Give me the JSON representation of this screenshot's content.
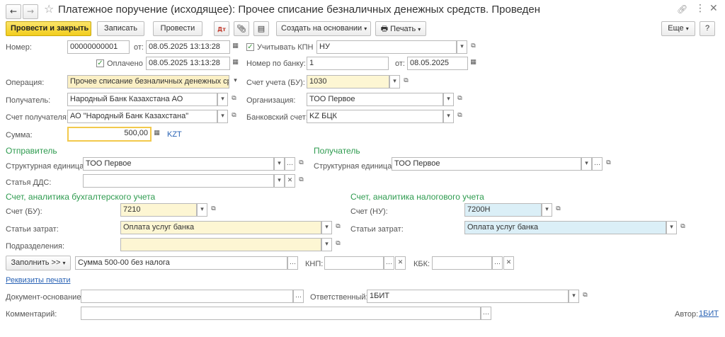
{
  "window": {
    "title": "Платежное поручение (исходящее): Прочее списание безналичных денежных средств. Проведен",
    "back_icon": "arrow-left-icon",
    "forward_icon": "arrow-right-icon",
    "star_icon": "star-outline-icon",
    "link_icon": "link-icon",
    "more_icon": "vertical-dots-icon",
    "close_icon": "close-icon"
  },
  "toolbar": {
    "post_close": "Провести и закрыть",
    "save": "Записать",
    "post": "Провести",
    "create_based": "Создать на основании",
    "print": "Печать",
    "more": "Еще",
    "help": "?"
  },
  "header": {
    "number_label": "Номер:",
    "number_value": "00000000001",
    "from_label": "от:",
    "date_value": "08.05.2025 13:13:28",
    "kpn_label": "Учитывать КПН",
    "kpn_checked": true,
    "kpn_value": "НУ",
    "paid_label": "Оплачено",
    "paid_checked": true,
    "paid_date": "08.05.2025 13:13:28",
    "bank_number_label": "Номер по банку:",
    "bank_number_value": "1",
    "bank_from_label": "от:",
    "bank_date": "08.05.2025"
  },
  "main": {
    "operation_label": "Операция:",
    "operation_value": "Прочее списание безналичных денежных сред",
    "account_bu_label": "Счет учета (БУ):",
    "account_bu_value": "1030",
    "recipient_label": "Получатель:",
    "recipient_value": "Народный Банк Казахстана АО",
    "organization_label": "Организация:",
    "organization_value": "ТОО Первое",
    "recipient_account_label": "Счет получателя:",
    "recipient_account_value": "АО \"Народный Банк Казахстана\"",
    "bank_account_label": "Банковский счет:",
    "bank_account_value": "KZ БЦК",
    "amount_label": "Сумма:",
    "amount_value": "500,00",
    "currency": "KZT"
  },
  "sender": {
    "heading": "Отправитель",
    "unit_label": "Структурная единица:",
    "unit_value": "ТОО Первое",
    "dds_label": "Статья ДДС:",
    "dds_value": ""
  },
  "receiver": {
    "heading": "Получатель",
    "unit_label": "Структурная единица:",
    "unit_value": "ТОО Первое"
  },
  "accounting": {
    "heading": "Счет, аналитика бухгалтерского учета",
    "account_label": "Счет (БУ):",
    "account_value": "7210",
    "expense_label": "Статьи затрат:",
    "expense_value": "Оплата услуг банка",
    "dept_label": "Подразделения:",
    "dept_value": ""
  },
  "tax": {
    "heading": "Счет, аналитика налогового учета",
    "account_label": "Счет (НУ):",
    "account_value": "7200Н",
    "expense_label": "Статьи затрат:",
    "expense_value": "Оплата услуг банка"
  },
  "purpose": {
    "fill_button": "Заполнить >>",
    "text": "Сумма 500-00   без налога",
    "knp_label": "КНП:",
    "knp_value": "",
    "kbk_label": "КБК:",
    "kbk_value": ""
  },
  "footer": {
    "print_details_link": "Реквизиты печати",
    "base_doc_label": "Документ-основание:",
    "base_doc_value": "",
    "responsible_label": "Ответственный:",
    "responsible_value": "1БИТ",
    "comment_label": "Комментарий:",
    "comment_value": "",
    "author_label": "Автор:",
    "author_value": "1БИТ"
  },
  "colors": {
    "accent_green": "#2e9b4f",
    "primary_button": "#f2cd1d",
    "link": "#2a63b5",
    "field_yellow": "#fbf0c5",
    "field_blue": "#dbeff7"
  }
}
